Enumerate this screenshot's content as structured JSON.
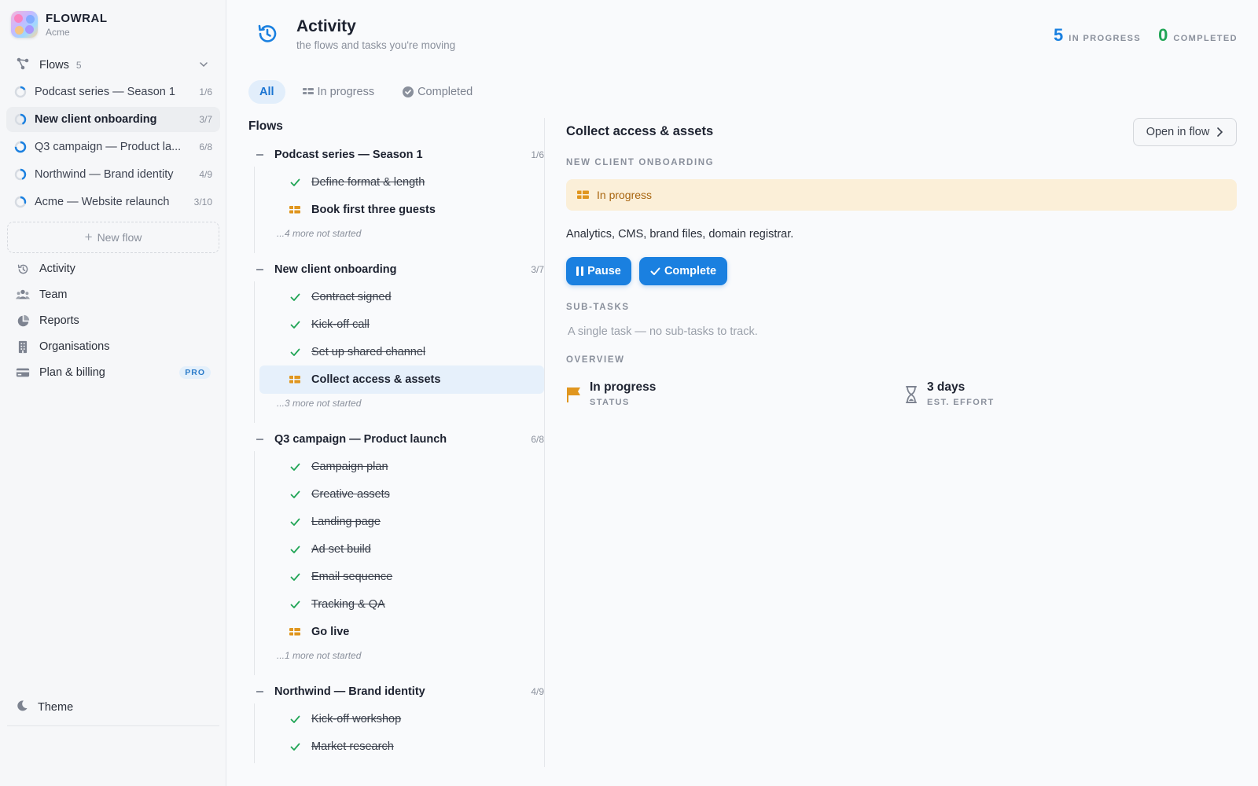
{
  "app": {
    "name": "FLOWRAL",
    "org": "Acme"
  },
  "sidebar": {
    "flows_label": "Flows",
    "flows_count": "5",
    "flows": [
      {
        "name": "Podcast series — Season 1",
        "progress": "1/6",
        "fraction": 0.17,
        "active": false
      },
      {
        "name": "New client onboarding",
        "progress": "3/7",
        "fraction": 0.43,
        "active": true
      },
      {
        "name": "Q3 campaign — Product la...",
        "progress": "6/8",
        "fraction": 0.75,
        "active": false
      },
      {
        "name": "Northwind — Brand identity",
        "progress": "4/9",
        "fraction": 0.44,
        "active": false
      },
      {
        "name": "Acme — Website relaunch",
        "progress": "3/10",
        "fraction": 0.3,
        "active": false
      }
    ],
    "new_flow": "New flow",
    "nav": [
      {
        "label": "Activity",
        "icon": "history-icon"
      },
      {
        "label": "Team",
        "icon": "team-icon"
      },
      {
        "label": "Reports",
        "icon": "pie-chart-icon"
      },
      {
        "label": "Organisations",
        "icon": "building-icon"
      },
      {
        "label": "Plan & billing",
        "icon": "credit-card-icon",
        "badge": "PRO"
      }
    ],
    "theme": "Theme"
  },
  "header": {
    "title": "Activity",
    "subtitle": "the flows and tasks you're moving",
    "in_progress_count": "5",
    "in_progress_label": "IN PROGRESS",
    "completed_count": "0",
    "completed_label": "COMPLETED"
  },
  "tabs": [
    {
      "label": "All",
      "active": true
    },
    {
      "label": "In progress",
      "active": false
    },
    {
      "label": "Completed",
      "active": false
    }
  ],
  "flows_column": {
    "heading": "Flows",
    "groups": [
      {
        "name": "Podcast series — Season 1",
        "progress": "1/6",
        "tasks": [
          {
            "name": "Define format & length",
            "status": "done"
          },
          {
            "name": "Book first three guests",
            "status": "in-progress"
          }
        ],
        "more": "...4 more not started"
      },
      {
        "name": "New client onboarding",
        "progress": "3/7",
        "tasks": [
          {
            "name": "Contract signed",
            "status": "done"
          },
          {
            "name": "Kick-off call",
            "status": "done"
          },
          {
            "name": "Set up shared channel",
            "status": "done"
          },
          {
            "name": "Collect access & assets",
            "status": "in-progress",
            "selected": true
          }
        ],
        "more": "...3 more not started"
      },
      {
        "name": "Q3 campaign — Product launch",
        "progress": "6/8",
        "tasks": [
          {
            "name": "Campaign plan",
            "status": "done"
          },
          {
            "name": "Creative assets",
            "status": "done"
          },
          {
            "name": "Landing page",
            "status": "done"
          },
          {
            "name": "Ad set build",
            "status": "done"
          },
          {
            "name": "Email sequence",
            "status": "done"
          },
          {
            "name": "Tracking & QA",
            "status": "done"
          },
          {
            "name": "Go live",
            "status": "in-progress"
          }
        ],
        "more": "...1 more not started"
      },
      {
        "name": "Northwind — Brand identity",
        "progress": "4/9",
        "tasks": [
          {
            "name": "Kick-off workshop",
            "status": "done"
          },
          {
            "name": "Market research",
            "status": "done"
          }
        ],
        "more": ""
      }
    ]
  },
  "detail": {
    "title": "Collect access & assets",
    "open_in_flow": "Open in flow",
    "flow_name": "NEW CLIENT ONBOARDING",
    "status": "In progress",
    "description": "Analytics, CMS, brand files, domain registrar.",
    "pause_label": "Pause",
    "complete_label": "Complete",
    "subtasks_label": "SUB-TASKS",
    "subtasks_empty": "A single task — no sub-tasks to track.",
    "overview_label": "OVERVIEW",
    "overview_status_value": "In progress",
    "overview_status_label": "STATUS",
    "overview_effort_value": "3 days",
    "overview_effort_label": "EST. EFFORT"
  },
  "colors": {
    "accent": "#1a80e0",
    "completed_green": "#21a556",
    "in_progress_amber": "#e0961f",
    "status_bg": "#fbefd8"
  }
}
